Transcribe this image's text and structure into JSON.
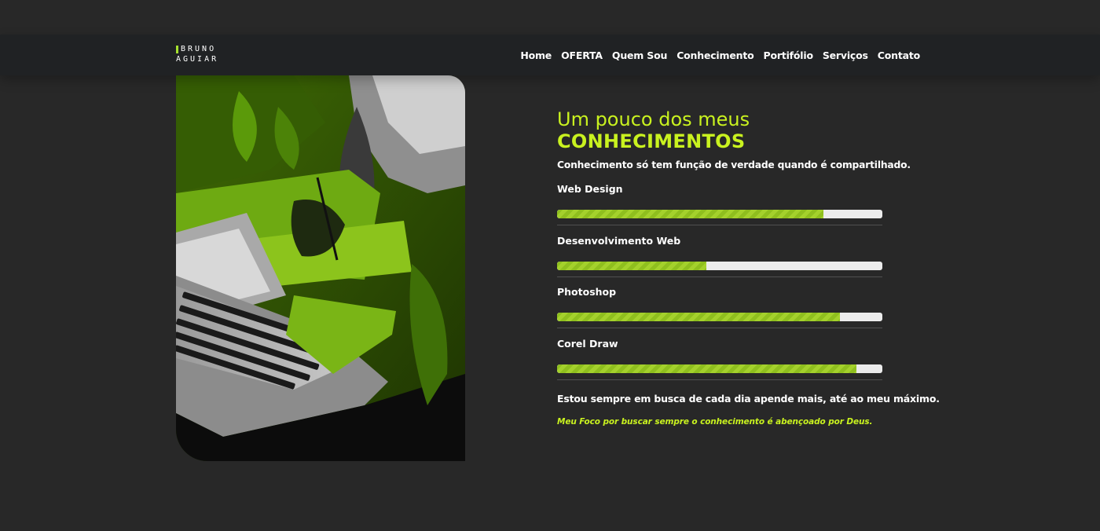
{
  "brand": {
    "line1": "BRUNO",
    "line2": "AGUIAR"
  },
  "nav": {
    "items": [
      "Home",
      "OFERTA",
      "Quem Sou",
      "Conhecimento",
      "Portifólio",
      "Serviços",
      "Contato"
    ]
  },
  "section": {
    "title_line1": "Um pouco dos meus",
    "title_line2": "CONHECIMENTOS",
    "subtitle": "Conhecimento só tem função de verdade quando é compartilhado.",
    "skills": [
      {
        "label": "Web Design",
        "level": 0.82
      },
      {
        "label": "Desenvolvimento Web",
        "level": 0.46
      },
      {
        "label": "Photoshop",
        "level": 0.87
      },
      {
        "label": "Corel Draw",
        "level": 0.92
      }
    ],
    "closing": "Estou sempre em busca de cada dia apende mais, até ao meu máximo.",
    "quote": "Meu Foco por buscar sempre o conhecimento é abençoado por Deus."
  },
  "colors": {
    "accent": "#c9f21f",
    "bar_fill": "#9acb25",
    "bar_track": "#ececec",
    "background": "#282828",
    "navbar": "#202224"
  }
}
